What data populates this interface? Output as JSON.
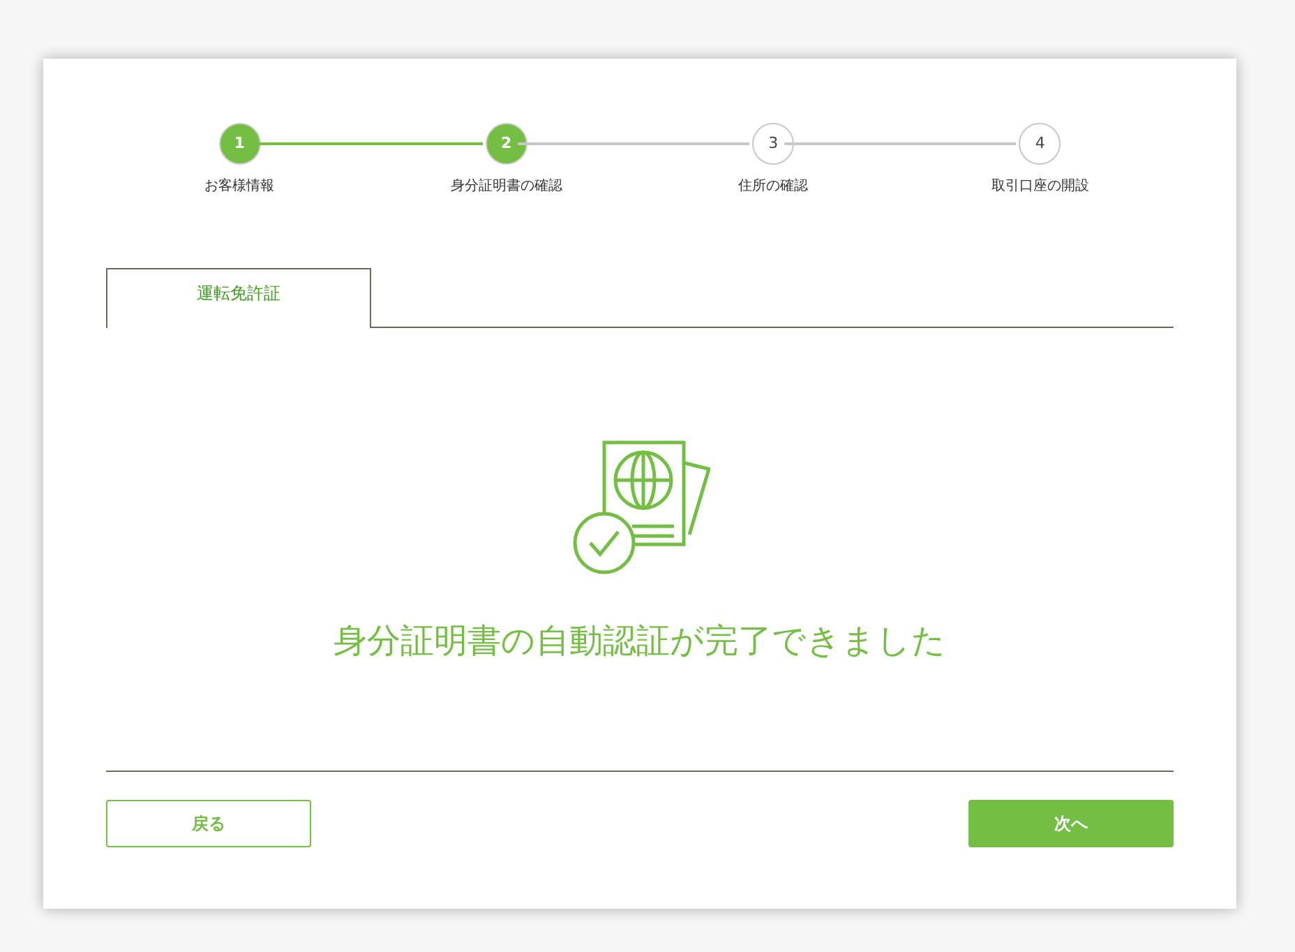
{
  "steps": [
    {
      "number": "1",
      "label": "お客様情報",
      "completed": true
    },
    {
      "number": "2",
      "label": "身分証明書の確認",
      "completed": true
    },
    {
      "number": "3",
      "label": "住所の確認",
      "completed": false
    },
    {
      "number": "4",
      "label": "取引口座の開設",
      "completed": false
    }
  ],
  "tabs": [
    {
      "label": "運転免許証",
      "selected": true
    }
  ],
  "message": "身分証明書の自動認証が完了できました",
  "buttons": {
    "back": "戻る",
    "next": "次へ"
  }
}
